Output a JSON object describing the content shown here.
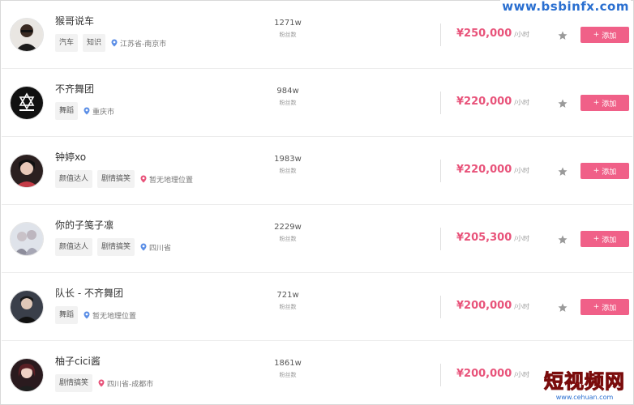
{
  "watermark_top": "www.bsbinfx.com",
  "watermark_bottom": {
    "title": "短视频网",
    "url": "www.cehuan.com"
  },
  "fans_label": "粉丝数",
  "price_unit": "/小时",
  "add_label": "添加",
  "colors": {
    "price": "#e8537a",
    "button": "#f06088",
    "tag_bg": "#f2f2f2",
    "pin": "#5b8ee6"
  },
  "rows": [
    {
      "name": "猴哥说车",
      "tags": [
        "汽车",
        "知识"
      ],
      "location": "江苏省-南京市",
      "fans": "1271w",
      "price": "¥250,000",
      "avatar": "man-with-glasses"
    },
    {
      "name": "不齐舞团",
      "tags": [
        "舞蹈"
      ],
      "location": "重庆市",
      "fans": "984w",
      "price": "¥220,000",
      "avatar": "dance-troupe-logo"
    },
    {
      "name": "钟婷xo",
      "tags": [
        "颜值达人",
        "剧情搞笑"
      ],
      "location": "暂无地理位置",
      "fans": "1983w",
      "price": "¥220,000",
      "avatar": "woman-portrait"
    },
    {
      "name": "你的子笺子凛",
      "tags": [
        "颜值达人",
        "剧情搞笑"
      ],
      "location": "四川省",
      "fans": "2229w",
      "price": "¥205,300",
      "avatar": "couple-portrait"
    },
    {
      "name": "队长 - 不齐舞团",
      "tags": [
        "舞蹈"
      ],
      "location": "暂无地理位置",
      "fans": "721w",
      "price": "¥200,000",
      "avatar": "man-portrait"
    },
    {
      "name": "柚子cici酱",
      "tags": [
        "剧情搞笑"
      ],
      "location": "四川省-成都市",
      "fans": "1861w",
      "price": "¥200,000",
      "avatar": "woman-portrait-2"
    }
  ]
}
